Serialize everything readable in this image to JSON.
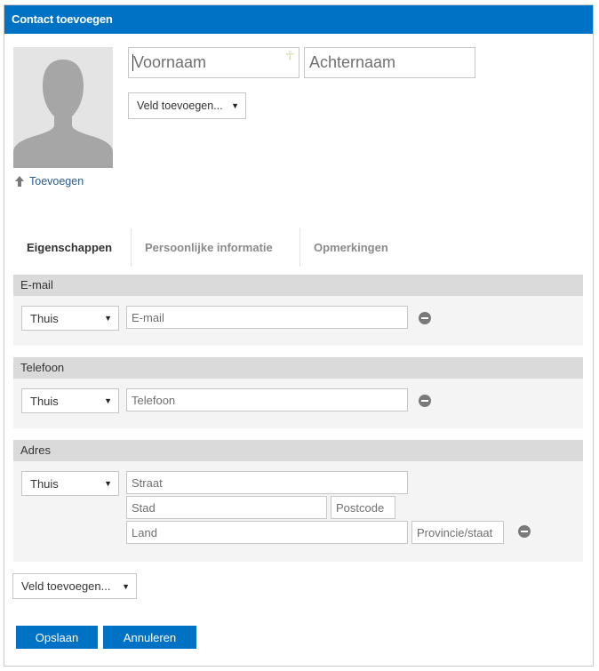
{
  "window": {
    "title": "Contact toevoegen"
  },
  "photo": {
    "upload_label": "Toevoegen"
  },
  "name": {
    "first_placeholder": "Voornaam",
    "last_placeholder": "Achternaam",
    "first_value": "",
    "last_value": ""
  },
  "add_field_top": {
    "label": "Veld toevoegen..."
  },
  "tabs": [
    {
      "label": "Eigenschappen",
      "active": true
    },
    {
      "label": "Persoonlijke informatie",
      "active": false
    },
    {
      "label": "Opmerkingen",
      "active": false
    }
  ],
  "email": {
    "header": "E-mail",
    "type": "Thuis",
    "placeholder": "E-mail"
  },
  "phone": {
    "header": "Telefoon",
    "type": "Thuis",
    "placeholder": "Telefoon"
  },
  "address": {
    "header": "Adres",
    "type": "Thuis",
    "street_placeholder": "Straat",
    "city_placeholder": "Stad",
    "postcode_placeholder": "Postcode",
    "country_placeholder": "Land",
    "province_placeholder": "Provincie/staat"
  },
  "add_field_bottom": {
    "label": "Veld toevoegen..."
  },
  "actions": {
    "save_label": "Opslaan",
    "cancel_label": "Annuleren"
  },
  "colors": {
    "accent": "#0072c6",
    "section_header": "#dadada",
    "section_body": "#f4f4f4"
  }
}
